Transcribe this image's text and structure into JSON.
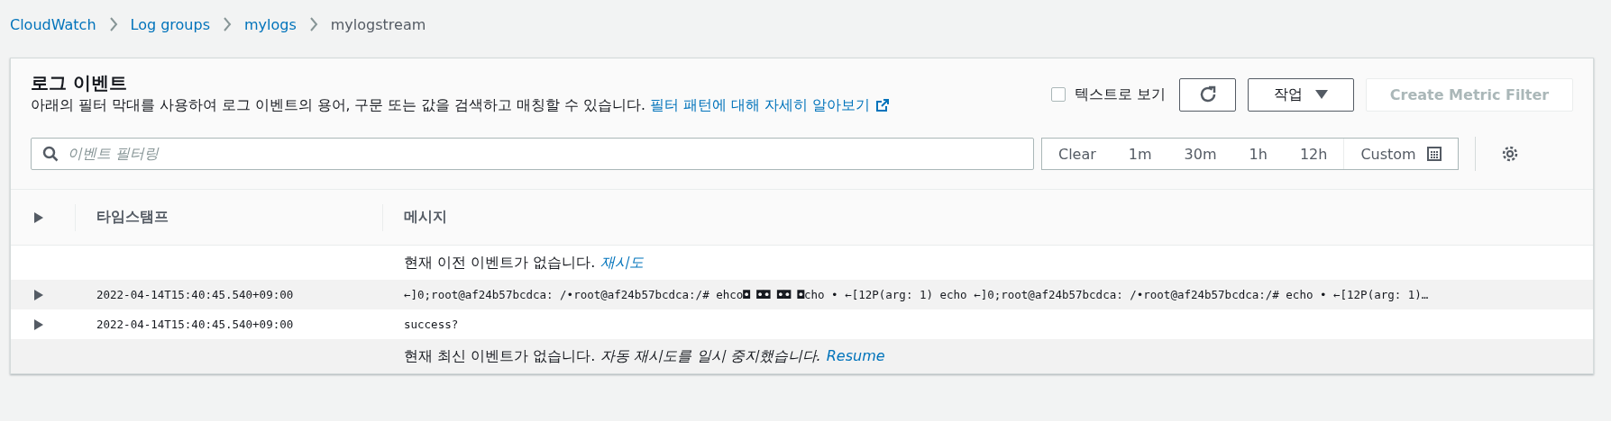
{
  "breadcrumb": [
    {
      "label": "CloudWatch",
      "kind": "link"
    },
    {
      "label": "Log groups",
      "kind": "link"
    },
    {
      "label": "mylogs",
      "kind": "link"
    },
    {
      "label": "mylogstream",
      "kind": "current"
    }
  ],
  "panel": {
    "title": "로그 이벤트",
    "description": "아래의 필터 막대를 사용하여 로그 이벤트의 용어, 구문 또는 값을 검색하고 매칭할 수 있습니다.",
    "learn_more_link": "필터 패턴에 대해 자세히 알아보기",
    "view_as_text": {
      "label": "텍스트로 보기",
      "checked": false
    },
    "actions_button": "작업",
    "create_button": {
      "label": "Create Metric Filter",
      "disabled": true
    }
  },
  "filter": {
    "placeholder": "이벤트 필터링",
    "time_ranges": [
      {
        "label": "Clear",
        "kind": "text"
      },
      {
        "label": "1m",
        "kind": "text"
      },
      {
        "label": "30m",
        "kind": "text"
      },
      {
        "label": "1h",
        "kind": "text"
      },
      {
        "label": "12h",
        "kind": "text"
      },
      {
        "label": "Custom",
        "kind": "calendar"
      }
    ]
  },
  "table": {
    "columns": [
      "타임스탬프",
      "메시지"
    ],
    "rows": [
      {
        "kind": "notice",
        "text": "현재 이전 이벤트가 없습니다.",
        "link": "재시도"
      },
      {
        "kind": "event",
        "timestamp": "2022-04-14T15:40:45.540+09:00",
        "message": "←]0;root@af24b57bcdca: /•root@af24b57bcdca:/# ehco◘ ◘◘ ◘◘ ◘cho • ←[12P(arg: 1) echo ←]0;root@af24b57bcdca: /•root@af24b57bcdca:/# echo • ←[12P(arg: 1)…"
      },
      {
        "kind": "event",
        "timestamp": "2022-04-14T15:40:45.540+09:00",
        "message": "success?"
      },
      {
        "kind": "notice",
        "text": "현재 최신 이벤트가 없습니다.",
        "note": "자동 재시도를 일시 중지했습니다.",
        "link": "Resume"
      }
    ]
  }
}
